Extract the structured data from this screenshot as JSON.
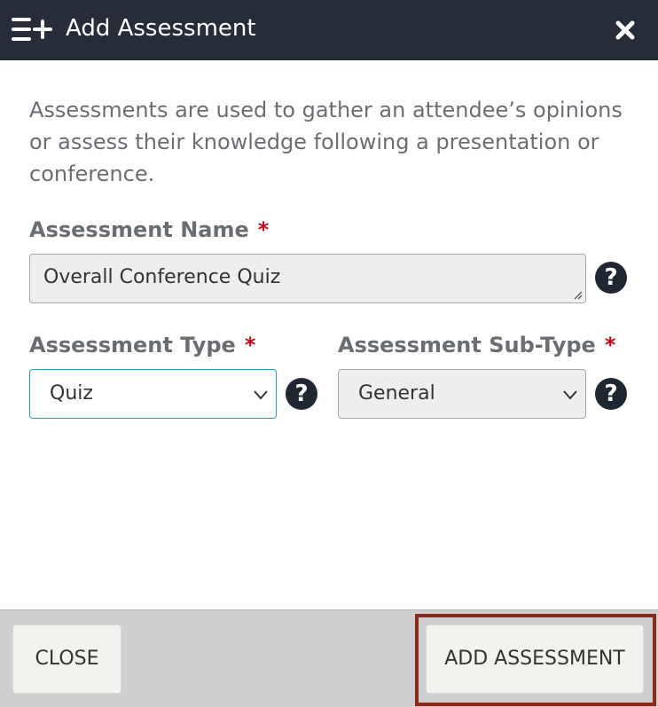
{
  "dialog": {
    "title": "Add Assessment",
    "header_icon": "list-add-icon",
    "close_icon": "close-icon"
  },
  "intro_text": "Assessments are used to gather an attendee’s opinions or assess their knowledge following a presentation or conference.",
  "fields": {
    "name": {
      "label": "Assessment Name",
      "required": "*",
      "value": "Overall Conference Quiz",
      "help": "?"
    },
    "type": {
      "label": "Assessment Type",
      "required": "*",
      "value": "Quiz",
      "help": "?"
    },
    "subtype": {
      "label": "Assessment Sub-Type",
      "required": "*",
      "value": "General",
      "help": "?"
    }
  },
  "footer": {
    "close_label": "CLOSE",
    "add_label": "ADD ASSESSMENT"
  },
  "colors": {
    "header_bg": "#262c38",
    "required": "#d0021b",
    "focus_border": "#1aa3b8",
    "highlight": "#8b2a1d"
  }
}
